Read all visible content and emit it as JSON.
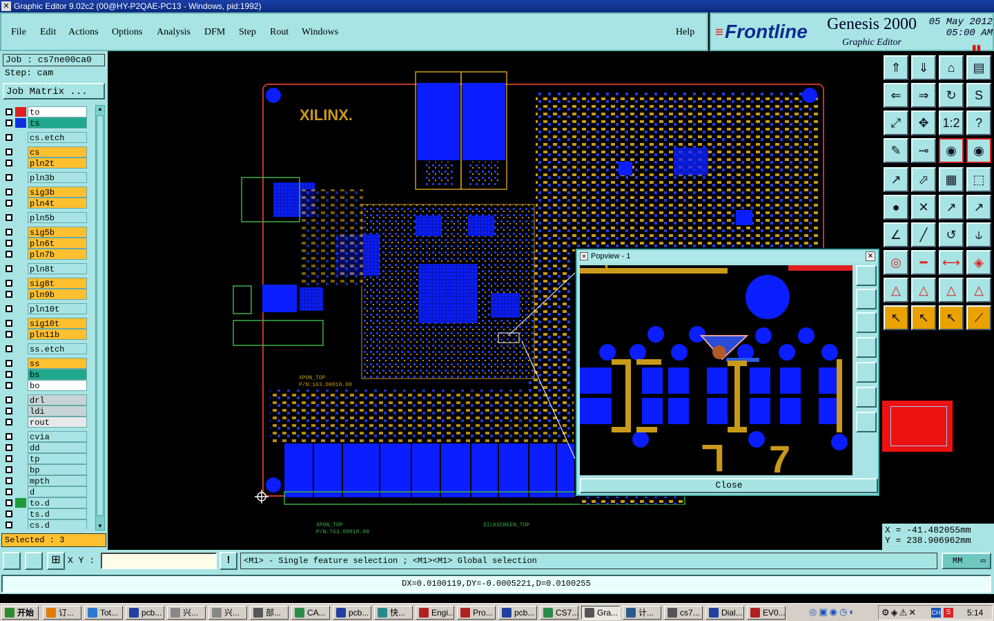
{
  "window": {
    "title": "Graphic Editor 9.02c2 (00@HY-P2QAE-PC13 - Windows, pid:1992)"
  },
  "menu": {
    "items": [
      "File",
      "Edit",
      "Actions",
      "Options",
      "Analysis",
      "DFM",
      "Step",
      "Rout",
      "Windows"
    ],
    "help": "Help"
  },
  "brand": {
    "logo": "Frontline",
    "product": "Genesis 2000",
    "subtitle": "Graphic Editor",
    "date": "05 May 2012",
    "time": "05:00 AM"
  },
  "job": {
    "job_label": "Job : cs7ne00ca0",
    "step_label": "Step: cam",
    "matrix_button": "Job Matrix ..."
  },
  "layers": [
    {
      "name": "to",
      "bg": "#ffffff",
      "swatch": "#e02020",
      "gap": false
    },
    {
      "name": "ts",
      "bg": "#1fa88c",
      "swatch": "#1030e0",
      "gap": false
    },
    {
      "name": "cs.etch",
      "bg": "#a8e4e4",
      "swatch": "",
      "gap": true
    },
    {
      "name": "cs",
      "bg": "#ffc030",
      "swatch": "",
      "gap": true
    },
    {
      "name": "pln2t",
      "bg": "#ffc030",
      "swatch": "",
      "gap": false
    },
    {
      "name": "pln3b",
      "bg": "#a8e4e4",
      "swatch": "",
      "gap": true
    },
    {
      "name": "sig3b",
      "bg": "#ffc030",
      "swatch": "",
      "gap": true
    },
    {
      "name": "pln4t",
      "bg": "#ffc030",
      "swatch": "",
      "gap": false
    },
    {
      "name": "pln5b",
      "bg": "#a8e4e4",
      "swatch": "",
      "gap": true
    },
    {
      "name": "sig5b",
      "bg": "#ffc030",
      "swatch": "",
      "gap": true
    },
    {
      "name": "pln6t",
      "bg": "#ffc030",
      "swatch": "",
      "gap": false
    },
    {
      "name": "pln7b",
      "bg": "#ffc030",
      "swatch": "",
      "gap": false
    },
    {
      "name": "pln8t",
      "bg": "#a8e4e4",
      "swatch": "",
      "gap": true
    },
    {
      "name": "sig8t",
      "bg": "#ffc030",
      "swatch": "",
      "gap": true
    },
    {
      "name": "pln9b",
      "bg": "#ffc030",
      "swatch": "",
      "gap": false
    },
    {
      "name": "pln10t",
      "bg": "#a8e4e4",
      "swatch": "",
      "gap": true
    },
    {
      "name": "sig10t",
      "bg": "#ffc030",
      "swatch": "",
      "gap": true
    },
    {
      "name": "pln11b",
      "bg": "#ffc030",
      "swatch": "",
      "gap": false
    },
    {
      "name": "ss.etch",
      "bg": "#a8e4e4",
      "swatch": "",
      "gap": true
    },
    {
      "name": "ss",
      "bg": "#ffc030",
      "swatch": "",
      "gap": true
    },
    {
      "name": "bs",
      "bg": "#1fa88c",
      "swatch": "",
      "gap": false
    },
    {
      "name": "bo",
      "bg": "#ffffff",
      "swatch": "",
      "gap": false
    },
    {
      "name": "drl",
      "bg": "#c8d4d4",
      "swatch": "",
      "gap": true
    },
    {
      "name": "ldi",
      "bg": "#c8d4d4",
      "swatch": "",
      "gap": false
    },
    {
      "name": "rout",
      "bg": "#e8e8e8",
      "swatch": "",
      "gap": false
    },
    {
      "name": "cvia",
      "bg": "#a8e4e4",
      "swatch": "",
      "gap": true
    },
    {
      "name": "dd",
      "bg": "#a8e4e4",
      "swatch": "",
      "gap": false
    },
    {
      "name": "tp",
      "bg": "#a8e4e4",
      "swatch": "",
      "gap": false
    },
    {
      "name": "bp",
      "bg": "#a8e4e4",
      "swatch": "",
      "gap": false
    },
    {
      "name": "mpth",
      "bg": "#a8e4e4",
      "swatch": "",
      "gap": false
    },
    {
      "name": "d",
      "bg": "#a8e4e4",
      "swatch": "",
      "gap": false
    },
    {
      "name": "to.d",
      "bg": "#a8e4e4",
      "swatch": "#1f9a3a",
      "gap": false
    },
    {
      "name": "ts.d",
      "bg": "#a8e4e4",
      "swatch": "",
      "gap": false
    },
    {
      "name": "cs.d",
      "bg": "#a8e4e4",
      "swatch": "",
      "gap": false
    }
  ],
  "selected": "Selected : 3",
  "board": {
    "logo": "XILINX.",
    "silk1": "XPON_TOP",
    "silk2": "P/N:163.00018.00",
    "silk3": "XPON_TOP",
    "silk4": "P/N:T63.00018.00",
    "silk5": "SILKSCREEN_TOP"
  },
  "popview": {
    "title": "Popview - 1",
    "close_label": "Close"
  },
  "coords": {
    "x": "X = -41.482055mm",
    "y": "Y = 238.906962mm"
  },
  "bottom": {
    "xy_label": "X Y :",
    "xy_value": "",
    "hint": "<M1> - Single feature selection ; <M1><M1> Global selection",
    "units": "MM",
    "measure": "DX=0.0100119,DY=-0.0005221,D=0.0100255"
  },
  "taskbar": {
    "start": "开始",
    "items": [
      "订...",
      "Tot...",
      "pcb...",
      "兴...",
      "兴...",
      "部...",
      "CA...",
      "pcb...",
      "快...",
      "Engi...",
      "Pro...",
      "pcb...",
      "CS7...",
      "Gra...",
      "计...",
      "cs7...",
      "Dial...",
      "EV0..."
    ],
    "active_index": 13,
    "clock": "5:14"
  },
  "colors": {
    "panel": "#a8e4e4",
    "accent": "#ffc030",
    "copper": "#d4a017",
    "pad": "#0a1eff"
  }
}
